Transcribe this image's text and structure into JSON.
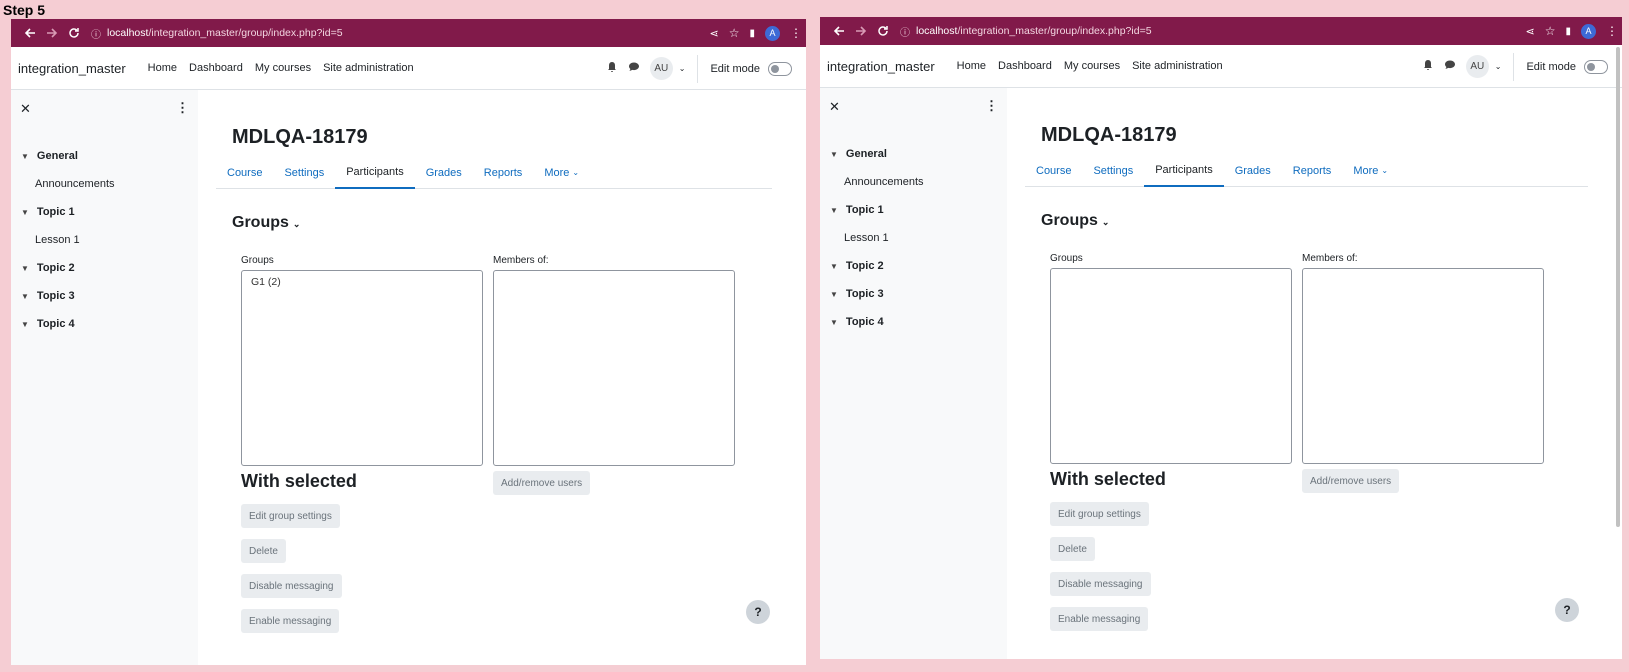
{
  "step_label": "Step 5",
  "browser": {
    "url_host": "localhost",
    "url_path": "/integration_master/group/index.php?id=5",
    "profile_initial": "A"
  },
  "site": {
    "brand": "integration_master",
    "nav": [
      "Home",
      "Dashboard",
      "My courses",
      "Site administration"
    ],
    "user_initials": "AU",
    "edit_mode_label": "Edit mode"
  },
  "drawer": {
    "sections": [
      {
        "title": "General",
        "items": [
          "Announcements"
        ]
      },
      {
        "title": "Topic 1",
        "items": [
          "Lesson 1"
        ]
      },
      {
        "title": "Topic 2",
        "items": []
      },
      {
        "title": "Topic 3",
        "items": []
      },
      {
        "title": "Topic 4",
        "items": []
      }
    ]
  },
  "course": {
    "title": "MDLQA-18179",
    "tabs": [
      "Course",
      "Settings",
      "Participants",
      "Grades",
      "Reports",
      "More"
    ],
    "active_tab": "Participants"
  },
  "page": {
    "heading": "Groups",
    "groups_label": "Groups",
    "members_label": "Members of:",
    "with_selected": "With selected",
    "add_remove_users": "Add/remove users",
    "edit_group_settings": "Edit group settings",
    "delete": "Delete",
    "disable_messaging": "Disable messaging",
    "enable_messaging": "Enable messaging",
    "help": "?"
  },
  "panel_left": {
    "groups_list": [
      "G1 (2)"
    ]
  },
  "panel_right": {
    "groups_list": []
  },
  "colors": {
    "chrome": "#811a4a",
    "link": "#0f6cbf",
    "background": "#f5cdd3"
  }
}
